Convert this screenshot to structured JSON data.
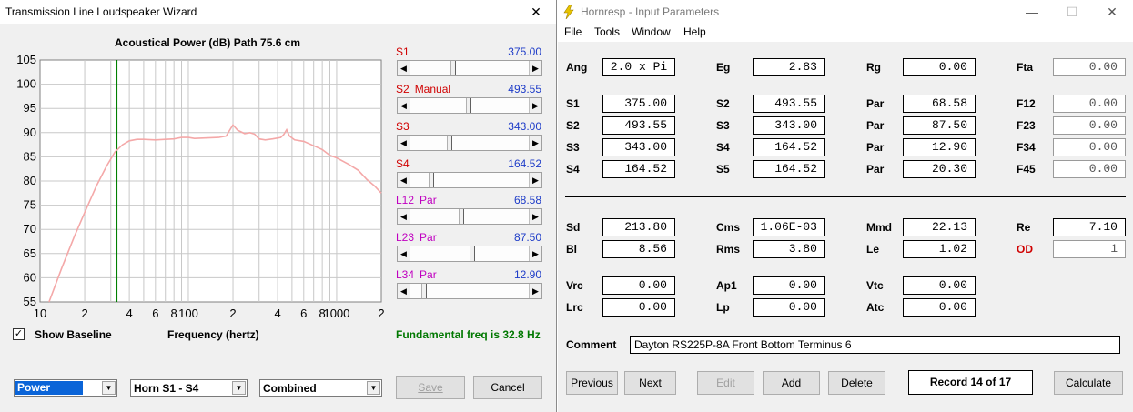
{
  "tl_window": {
    "title": "Transmission Line Loudspeaker Wizard",
    "close_glyph": "✕",
    "plot_title": "Acoustical Power (dB)   Path 75.6 cm",
    "x_axis_label": "Frequency (hertz)",
    "show_baseline_label": "Show Baseline",
    "show_baseline_checked": "✓",
    "fundamental_text": "Fundamental freq is 32.8 Hz",
    "sliders": [
      {
        "label": "S1",
        "tag": "",
        "value": "375.00",
        "label_color": "#d00000",
        "position": 0.34
      },
      {
        "label": "S2",
        "tag": "Manual",
        "value": "493.55",
        "label_color": "#d00000",
        "tag_color": "#d00000",
        "position": 0.47
      },
      {
        "label": "S3",
        "tag": "",
        "value": "343.00",
        "label_color": "#d00000",
        "position": 0.31
      },
      {
        "label": "S4",
        "tag": "",
        "value": "164.52",
        "label_color": "#d00000",
        "position": 0.15
      },
      {
        "label": "L12",
        "tag": "Par",
        "value": "68.58",
        "label_color": "#c000c0",
        "tag_color": "#c000c0",
        "position": 0.41
      },
      {
        "label": "L23",
        "tag": "Par",
        "value": "87.50",
        "label_color": "#c000c0",
        "tag_color": "#c000c0",
        "position": 0.5
      },
      {
        "label": "L34",
        "tag": "Par",
        "value": "12.90",
        "label_color": "#c000c0",
        "tag_color": "#c000c0",
        "position": 0.09
      }
    ],
    "combos": [
      {
        "value": "Power",
        "selected": true
      },
      {
        "value": "Horn S1 - S4",
        "selected": false
      },
      {
        "value": "Combined",
        "selected": false
      }
    ],
    "save_label": "Save",
    "cancel_label": "Cancel"
  },
  "chart_data": {
    "type": "line",
    "title": "Acoustical Power (dB)   Path 75.6 cm",
    "xlabel": "Frequency (hertz)",
    "ylabel": "",
    "x_scale": "log",
    "xlim": [
      10,
      2000
    ],
    "ylim": [
      55,
      105
    ],
    "y_ticks": [
      55,
      60,
      65,
      70,
      75,
      80,
      85,
      90,
      95,
      100,
      105
    ],
    "x_tick_labels": [
      {
        "x": 10,
        "label": "10"
      },
      {
        "x": 20,
        "label": "2"
      },
      {
        "x": 40,
        "label": "4"
      },
      {
        "x": 60,
        "label": "6"
      },
      {
        "x": 80,
        "label": "8"
      },
      {
        "x": 100,
        "label": "100"
      },
      {
        "x": 200,
        "label": "2"
      },
      {
        "x": 400,
        "label": "4"
      },
      {
        "x": 600,
        "label": "6"
      },
      {
        "x": 800,
        "label": "8"
      },
      {
        "x": 1000,
        "label": "1000"
      },
      {
        "x": 2000,
        "label": "2"
      }
    ],
    "grid": true,
    "marker_frequency": 32.8,
    "marker_color": "#008000",
    "series": [
      {
        "color": "#f4a8a8",
        "points": [
          [
            11.5,
            55
          ],
          [
            14,
            62
          ],
          [
            17,
            68.5
          ],
          [
            20,
            73.5
          ],
          [
            24,
            79
          ],
          [
            28,
            83
          ],
          [
            32,
            86
          ],
          [
            36,
            87.5
          ],
          [
            40,
            88.3
          ],
          [
            45,
            88.6
          ],
          [
            50,
            88.6
          ],
          [
            60,
            88.5
          ],
          [
            70,
            88.6
          ],
          [
            80,
            88.7
          ],
          [
            90,
            89
          ],
          [
            100,
            89
          ],
          [
            110,
            88.8
          ],
          [
            130,
            88.9
          ],
          [
            160,
            89
          ],
          [
            180,
            89.3
          ],
          [
            190,
            90.5
          ],
          [
            200,
            91.6
          ],
          [
            215,
            90.5
          ],
          [
            240,
            89.8
          ],
          [
            260,
            90
          ],
          [
            280,
            89.7
          ],
          [
            300,
            88.7
          ],
          [
            330,
            88.5
          ],
          [
            370,
            88.7
          ],
          [
            420,
            89
          ],
          [
            440,
            89.6
          ],
          [
            460,
            90.6
          ],
          [
            480,
            89.3
          ],
          [
            520,
            88.5
          ],
          [
            600,
            88.2
          ],
          [
            700,
            87.3
          ],
          [
            800,
            86.5
          ],
          [
            900,
            85.3
          ],
          [
            1000,
            84.8
          ],
          [
            1200,
            83.5
          ],
          [
            1400,
            82.2
          ],
          [
            1600,
            80.3
          ],
          [
            1800,
            79
          ],
          [
            2000,
            77.5
          ]
        ]
      }
    ]
  },
  "hr_window": {
    "title": "Hornresp - Input Parameters",
    "minimize_glyph": "—",
    "maximize_glyph": "☐",
    "close_glyph": "✕",
    "menu": [
      "File",
      "Tools",
      "Window",
      "Help"
    ],
    "params": {
      "ang": {
        "label": "Ang",
        "value": "2.0 x Pi"
      },
      "eg": {
        "label": "Eg",
        "value": "2.83"
      },
      "rg": {
        "label": "Rg",
        "value": "0.00"
      },
      "fta": {
        "label": "Fta",
        "value": "0.00"
      },
      "s1": {
        "label": "S1",
        "value": "375.00"
      },
      "s2b": {
        "label": "S2",
        "value": "493.55"
      },
      "par1": {
        "label": "Par",
        "value": "68.58"
      },
      "f12": {
        "label": "F12",
        "value": "0.00"
      },
      "s2": {
        "label": "S2",
        "value": "493.55"
      },
      "s3b": {
        "label": "S3",
        "value": "343.00"
      },
      "par2": {
        "label": "Par",
        "value": "87.50"
      },
      "f23": {
        "label": "F23",
        "value": "0.00"
      },
      "s3": {
        "label": "S3",
        "value": "343.00"
      },
      "s4b": {
        "label": "S4",
        "value": "164.52"
      },
      "par3": {
        "label": "Par",
        "value": "12.90"
      },
      "f34": {
        "label": "F34",
        "value": "0.00"
      },
      "s4": {
        "label": "S4",
        "value": "164.52"
      },
      "s5": {
        "label": "S5",
        "value": "164.52"
      },
      "par4": {
        "label": "Par",
        "value": "20.30"
      },
      "f45": {
        "label": "F45",
        "value": "0.00"
      },
      "sd": {
        "label": "Sd",
        "value": "213.80"
      },
      "cms": {
        "label": "Cms",
        "value": "1.06E-03"
      },
      "mmd": {
        "label": "Mmd",
        "value": "22.13"
      },
      "re": {
        "label": "Re",
        "value": "7.10"
      },
      "bl": {
        "label": "Bl",
        "value": "8.56"
      },
      "rms": {
        "label": "Rms",
        "value": "3.80"
      },
      "le": {
        "label": "Le",
        "value": "1.02"
      },
      "od": {
        "label": "OD",
        "value": "1"
      },
      "vrc": {
        "label": "Vrc",
        "value": "0.00"
      },
      "ap1": {
        "label": "Ap1",
        "value": "0.00"
      },
      "vtc": {
        "label": "Vtc",
        "value": "0.00"
      },
      "lrc": {
        "label": "Lrc",
        "value": "0.00"
      },
      "lp": {
        "label": "Lp",
        "value": "0.00"
      },
      "atc": {
        "label": "Atc",
        "value": "0.00"
      }
    },
    "comment_label": "Comment",
    "comment_value": "Dayton RS225P-8A Front Bottom Terminus 6",
    "buttons": {
      "previous": "Previous",
      "next": "Next",
      "edit": "Edit",
      "add": "Add",
      "delete": "Delete",
      "calculate": "Calculate"
    },
    "record_text": "Record 14 of 17"
  }
}
